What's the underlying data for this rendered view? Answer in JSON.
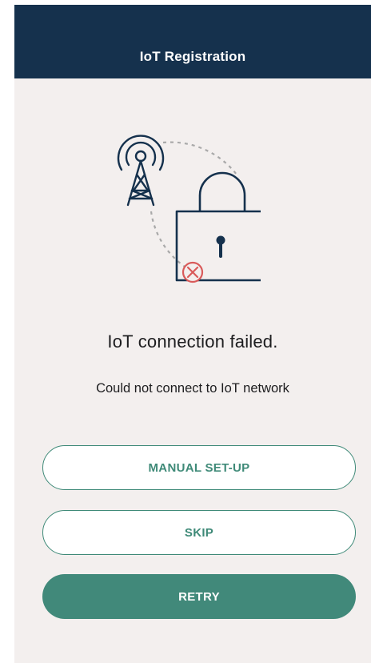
{
  "header": {
    "title": "IoT Registration"
  },
  "illustration": {
    "icons": [
      "antenna-tower-icon",
      "padlock-icon",
      "error-x-icon"
    ],
    "colors": {
      "stroke": "#15314d",
      "dashed_arc": "#a9a9a9",
      "error": "#d95a5a"
    }
  },
  "status": {
    "title": "IoT connection failed.",
    "message": "Could not connect to IoT network"
  },
  "actions": {
    "manual_setup_label": "MANUAL SET-UP",
    "skip_label": "SKIP",
    "retry_label": "RETRY"
  },
  "theme": {
    "header_bg": "#15314d",
    "page_bg": "#f3efee",
    "accent": "#41897a"
  }
}
